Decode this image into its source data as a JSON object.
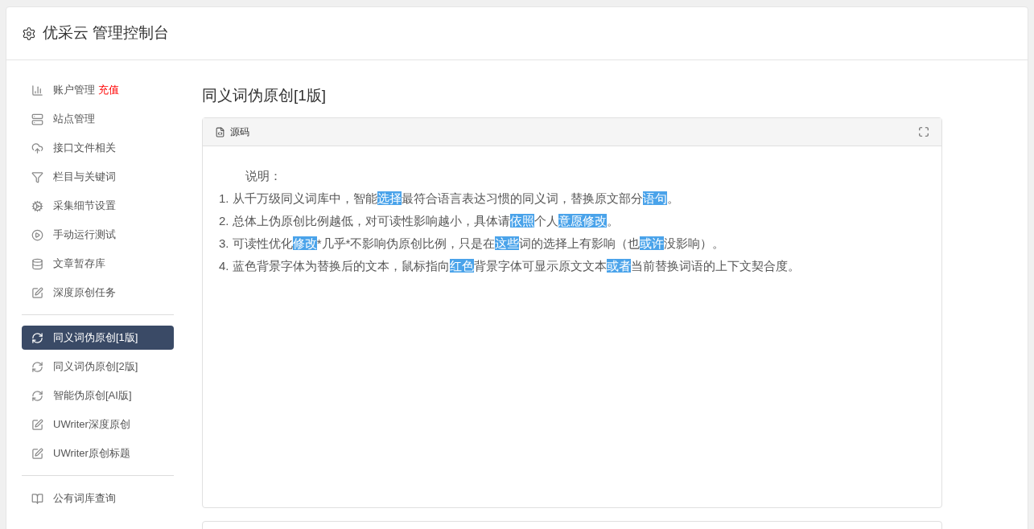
{
  "header": {
    "title": "优采云 管理控制台"
  },
  "sidebar": {
    "groups": [
      {
        "items": [
          {
            "label": "账户管理",
            "badge": "充值",
            "selected": false
          },
          {
            "label": "站点管理",
            "selected": false
          },
          {
            "label": "接口文件相关",
            "selected": false
          },
          {
            "label": "栏目与关键词",
            "selected": false
          },
          {
            "label": "采集细节设置",
            "selected": false
          },
          {
            "label": "手动运行测试",
            "selected": false
          },
          {
            "label": "文章暂存库",
            "selected": false
          },
          {
            "label": "深度原创任务",
            "selected": false
          }
        ]
      },
      {
        "items": [
          {
            "label": "同义词伪原创[1版]",
            "selected": true
          },
          {
            "label": "同义词伪原创[2版]",
            "selected": false
          },
          {
            "label": "智能伪原创[AI版]",
            "selected": false
          },
          {
            "label": "UWriter深度原创",
            "selected": false
          },
          {
            "label": "UWriter原创标题",
            "selected": false
          }
        ]
      },
      {
        "items": [
          {
            "label": "公有词库查询",
            "selected": false
          }
        ]
      }
    ]
  },
  "main": {
    "title": "同义词伪原创[1版]",
    "panel": {
      "tab": "源码",
      "heading": "说明：",
      "lines": [
        [
          {
            "text": "1. 从千万级同义词库中，智能",
            "highlighted": false
          },
          {
            "text": "选择",
            "highlighted": true
          },
          {
            "text": "最符合语言表达习惯的同义词，替换原文部分",
            "highlighted": false
          },
          {
            "text": "语句",
            "highlighted": true
          },
          {
            "text": "。",
            "highlighted": false
          }
        ],
        [
          {
            "text": "2. 总体上伪原创比例越低，对可读性影响越小，具体请",
            "highlighted": false
          },
          {
            "text": "依照",
            "highlighted": true
          },
          {
            "text": "个人",
            "highlighted": false
          },
          {
            "text": "意愿",
            "highlighted": true
          },
          {
            "text": "修改",
            "highlighted": true
          },
          {
            "text": "。",
            "highlighted": false
          }
        ],
        [
          {
            "text": "3. 可读性优化",
            "highlighted": false
          },
          {
            "text": "修改",
            "highlighted": true
          },
          {
            "text": "*几乎*不影响伪原创比例，只是在",
            "highlighted": false
          },
          {
            "text": "这些",
            "highlighted": true
          },
          {
            "text": "词的选择上有影响（也",
            "highlighted": false
          },
          {
            "text": "或许",
            "highlighted": true
          },
          {
            "text": "没影响）。",
            "highlighted": false
          }
        ],
        [
          {
            "text": "4. 蓝色背景字体为替换后的文本，鼠标指向",
            "highlighted": false
          },
          {
            "text": "红色",
            "highlighted": true
          },
          {
            "text": "背景字体可显示原文文本",
            "highlighted": false
          },
          {
            "text": "或者",
            "highlighted": true
          },
          {
            "text": "当前替换词语的上下文契合度。",
            "highlighted": false
          }
        ]
      ]
    }
  }
}
